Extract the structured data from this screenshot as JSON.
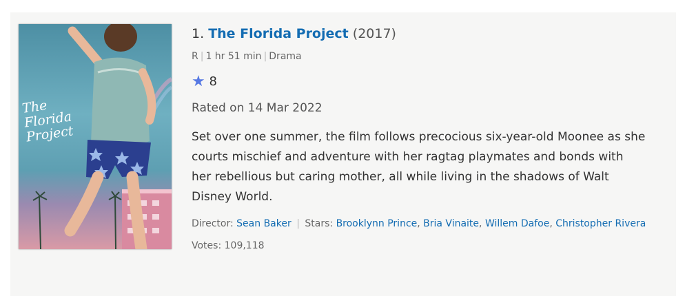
{
  "movie": {
    "rank": "1.",
    "title": "The Florida Project",
    "year": "(2017)",
    "certificate": "R",
    "runtime": "1 hr 51 min",
    "genre": "Drama",
    "user_rating": "8",
    "rated_on": "Rated on 14 Mar 2022",
    "description": "Set over one summer, the film follows precocious six-year-old Moonee as she courts mischief and adventure with her ragtag playmates and bonds with her rebellious but caring mother, all while living in the shadows of Walt Disney World.",
    "director_label": "Director:",
    "director": "Sean Baker",
    "stars_label": "Stars:",
    "stars": [
      "Brooklynn Prince",
      "Bria Vinaite",
      "Willem Dafoe",
      "Christopher Rivera"
    ],
    "votes_label": "Votes:",
    "votes": "109,118"
  },
  "poster": {
    "title_line1": "The",
    "title_line2": "Florida",
    "title_line3": "Project"
  },
  "icons": {
    "rating": "star-icon"
  },
  "colors": {
    "link": "#136cb2",
    "star": "#5779e3",
    "card_bg": "#f6f6f5"
  }
}
